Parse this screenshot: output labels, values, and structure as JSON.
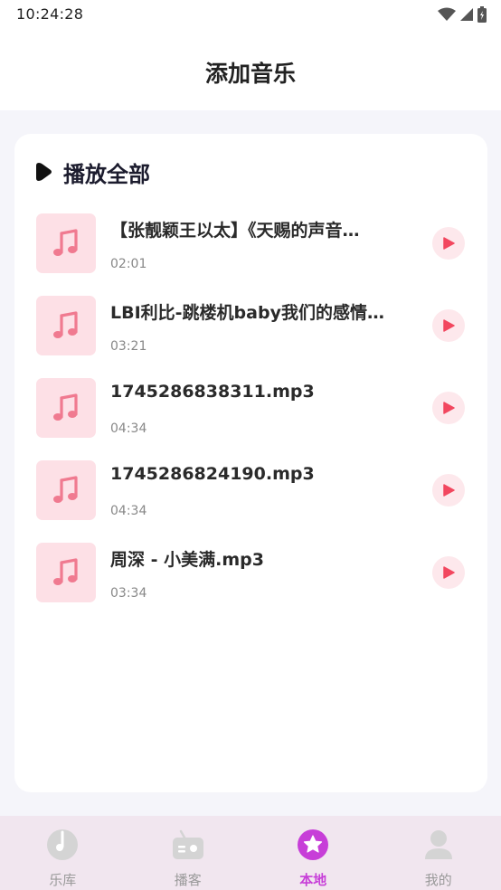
{
  "status_bar": {
    "time": "10:24:28"
  },
  "header": {
    "title": "添加音乐"
  },
  "play_all": {
    "label": "播放全部"
  },
  "tracks": [
    {
      "title": "【张靓颖王以太】《天赐的声音…",
      "duration": "02:01"
    },
    {
      "title": "LBI利比-跳楼机baby我们的感情…",
      "duration": "03:21"
    },
    {
      "title": "1745286838311.mp3",
      "duration": "04:34"
    },
    {
      "title": "1745286824190.mp3",
      "duration": "04:34"
    },
    {
      "title": "周深 - 小美满.mp3",
      "duration": "03:34"
    }
  ],
  "bottom_nav": [
    {
      "label": "乐库",
      "icon": "music-disc-icon",
      "active": false
    },
    {
      "label": "播客",
      "icon": "radio-icon",
      "active": false
    },
    {
      "label": "本地",
      "icon": "star-icon",
      "active": true
    },
    {
      "label": "我的",
      "icon": "user-icon",
      "active": false
    }
  ],
  "colors": {
    "accent": "#c73ed8",
    "play": "#f2475f",
    "thumb_bg": "#fde0e6",
    "nav_bg": "#f1e6ef"
  }
}
